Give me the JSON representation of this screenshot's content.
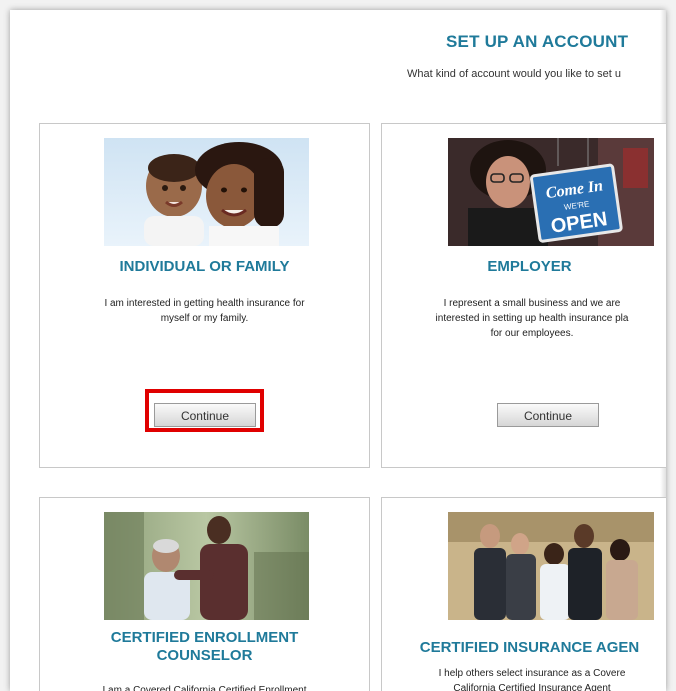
{
  "header": {
    "title": "SET UP AN ACCOUNT",
    "subtitle": "What kind of account would you like to set u"
  },
  "cards": [
    {
      "title": "INDIVIDUAL OR FAMILY",
      "description": "I am interested in getting health insurance for\nmyself or my family.",
      "button_label": "Continue"
    },
    {
      "title": "EMPLOYER",
      "description": "I represent a small business and we are\ninterested in setting up health insurance pla\nfor our employees.",
      "button_label": "Continue",
      "sign": {
        "line1": "Come In",
        "line2": "WE'RE",
        "line3": "OPEN"
      }
    },
    {
      "title": "CERTIFIED ENROLLMENT\nCOUNSELOR",
      "description": "I am a Covered California Certified Enrollment"
    },
    {
      "title": "CERTIFIED INSURANCE AGEN",
      "description": "I help others select insurance as a Covere\nCalifornia Certified Insurance Agent"
    }
  ],
  "annotation": {
    "highlight_color": "#e00000",
    "highlighted_element": "individual-continue-button"
  },
  "colors": {
    "accent": "#1f7a9a"
  }
}
